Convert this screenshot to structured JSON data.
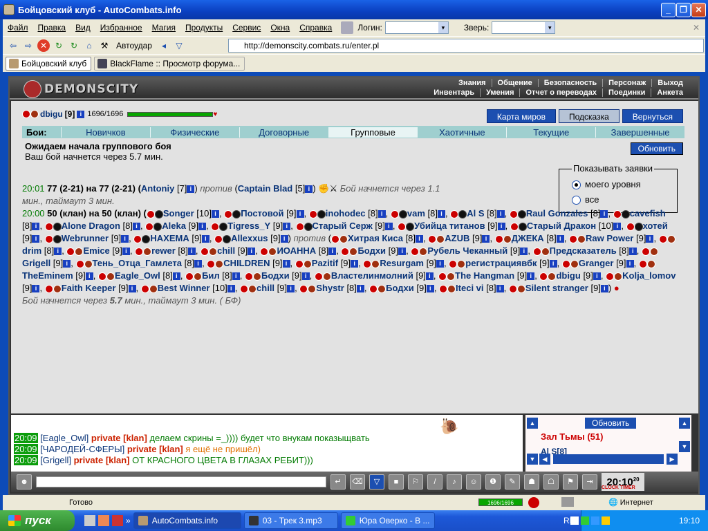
{
  "window": {
    "title": "Бойцовский клуб - AutoCombats.info",
    "buttons": [
      "_",
      "❐",
      "✕"
    ]
  },
  "menubar": {
    "items": [
      "Файл",
      "Правка",
      "Вид",
      "Избранное",
      "Магия",
      "Продукты",
      "Сервис",
      "Окна",
      "Справка"
    ],
    "login_label": "Логин:",
    "beast_label": "Зверь:"
  },
  "toolbar": {
    "autoudar": "Автоудар",
    "address": "http://demonscity.combats.ru/enter.pl"
  },
  "browser_tabs": [
    {
      "label": "Бойцовский клуб",
      "active": true
    },
    {
      "label": "BlackFlame :: Просмотр форума...",
      "active": false
    }
  ],
  "header": {
    "logo": "DEMONSCITY",
    "nav_row1": [
      "Знания",
      "Общение",
      "Безопасность",
      "Персонаж",
      "Выход"
    ],
    "nav_row2": [
      "Инвентарь",
      "Умения",
      "Отчет о переводах",
      "Поединки",
      "Анкета"
    ]
  },
  "user": {
    "name": "dbigu",
    "level": "[9]",
    "hp": "1696/1696",
    "hp_fraction": 1.0
  },
  "topbuttons": [
    "Карта миров",
    "Подсказка",
    "Вернуться"
  ],
  "boi": {
    "label": "Бои:",
    "tabs": [
      "Новичков",
      "Физические",
      "Договорные",
      "Групповые",
      "Хаотичные",
      "Текущие",
      "Завершенные"
    ],
    "current": "Групповые"
  },
  "waiting": {
    "heading": "Ожидаем начала группового боя",
    "text": "Ваш бой начнется через 5.7 мин.",
    "refresh": "Обновить"
  },
  "show_box": {
    "legend": "Показывать заявки",
    "options": [
      "моего уровня",
      "все"
    ],
    "selected": 0
  },
  "battle1": {
    "time": "20:01",
    "line": "77 (2-21) на 77 (2-21) (",
    "p1": "Antoniy",
    "p1lvl": "[7]",
    "vs": "против",
    "p2": "Captain Blad",
    "p2lvl": "[5]",
    "start": "Бой начнется через 1.1",
    "start2": "мин., таймаут 3 мин."
  },
  "battle2": {
    "time": "20:00",
    "line": "50 (клан) на 50 (клан) (",
    "team1": [
      [
        "Songer",
        "[10]"
      ],
      [
        "Постовой",
        "[9]"
      ],
      [
        "inohodec",
        "[8]"
      ],
      [
        "vam",
        "[8]"
      ],
      [
        "Al S",
        "[8]"
      ],
      [
        "Raul Gonzales",
        "[8]"
      ],
      [
        "cavefish",
        "[8]"
      ],
      [
        "Alone Dragon",
        "[8]"
      ],
      [
        "Aleka",
        "[9]"
      ],
      [
        "Tigress_Y",
        "[9]"
      ],
      [
        "Старый Серж",
        "[9]"
      ],
      [
        "Убийца титанов",
        "[9]"
      ],
      [
        "Старый Дракон",
        "[10]"
      ],
      [
        "хотей",
        "[9]"
      ],
      [
        "Webrunner",
        "[9]"
      ],
      [
        "НАХЕМА",
        "[9]"
      ],
      [
        "Allexxus",
        "[9]"
      ]
    ],
    "vs": "против",
    "team2": [
      [
        "Хитрая Киса",
        "[8]"
      ],
      [
        "AZUB",
        "[9]"
      ],
      [
        "ДЖЕКА",
        "[8]"
      ],
      [
        "Raw Power",
        "[9]"
      ],
      [
        "drim",
        "[8]"
      ],
      [
        "Emice",
        "[9]"
      ],
      [
        "rewer",
        "[8]"
      ],
      [
        "chill",
        "[9]"
      ],
      [
        "ИОАННА",
        "[8]"
      ],
      [
        "Бодхи",
        "[9]"
      ],
      [
        "Рубель Чеканный",
        "[9]"
      ],
      [
        "Предсказатель",
        "[8]"
      ],
      [
        "Grigell",
        "[9]"
      ],
      [
        "Тень_Отца_Гамлета",
        "[8]"
      ],
      [
        "CHILDREN",
        "[9]"
      ],
      [
        "Pazitif",
        "[9]"
      ],
      [
        "Resurgam",
        "[9]"
      ],
      [
        "регистрациявбк",
        "[9]"
      ],
      [
        "Granger",
        "[9]"
      ],
      [
        "TheEminem",
        "[9]"
      ],
      [
        "Eagle_Owl",
        "[8]"
      ],
      [
        "Бил",
        "[8]"
      ],
      [
        "Бодхи",
        "[9]"
      ],
      [
        "Властелинмолний",
        "[9]"
      ],
      [
        "The Hangman",
        "[9]"
      ],
      [
        "dbigu",
        "[9]"
      ],
      [
        "Kolja_lomov",
        "[9]"
      ],
      [
        "Faith Keeper",
        "[9]"
      ],
      [
        "Best Winner",
        "[10]"
      ],
      [
        "chill",
        "[9]"
      ],
      [
        "Shystr",
        "[8]"
      ],
      [
        "Бодхи",
        "[9]"
      ],
      [
        "Iteci vi",
        "[8]"
      ],
      [
        "Silent stranger",
        "[9]"
      ]
    ],
    "footer_a": "Бой начнется через ",
    "footer_b": "5.7",
    "footer_c": " мин., таймаут 3 мин. ( БФ)"
  },
  "chat": [
    {
      "time": "20:09",
      "who": "[Eagle_Owl]",
      "private": "private [klan]",
      "msg": "делаем скрины =_)))) будет что внукам показыщвать"
    },
    {
      "time": "20:09",
      "who": "[ЧАРОДЕЙ-СФЕРЫ]",
      "private": "private [klan]",
      "msg": "я ещё не пришёл)"
    },
    {
      "time": "20:09",
      "who": "[Grigell]",
      "private": "private [klan]",
      "msg": "ОТ КРАСНОГО ЦВЕТА В ГЛАЗАХ РЕБИТ)))"
    }
  ],
  "room": {
    "refresh": "Обновить",
    "title": "Зал Тьмы (51)",
    "first": "Al S[8]"
  },
  "clock": {
    "time": "20:10",
    "sec": "20",
    "label1": "CLOCK",
    "label2": "TIMER"
  },
  "status": {
    "ready": "Готово",
    "hp": "1696/1696",
    "zone": "Интернет"
  },
  "taskbar": {
    "start": "пуск",
    "tasks": [
      "AutoCombats.info",
      "03 - Трек  3.mp3",
      "Юра Оверко - В ..."
    ],
    "lang": "RL",
    "time": "19:10"
  },
  "colors": {
    "link": "#0a3478",
    "accent_button": "#1c4fb0",
    "tab_bg": "#9fcfcf",
    "hp_green": "#07a500",
    "chat_private": "#cc2200"
  }
}
